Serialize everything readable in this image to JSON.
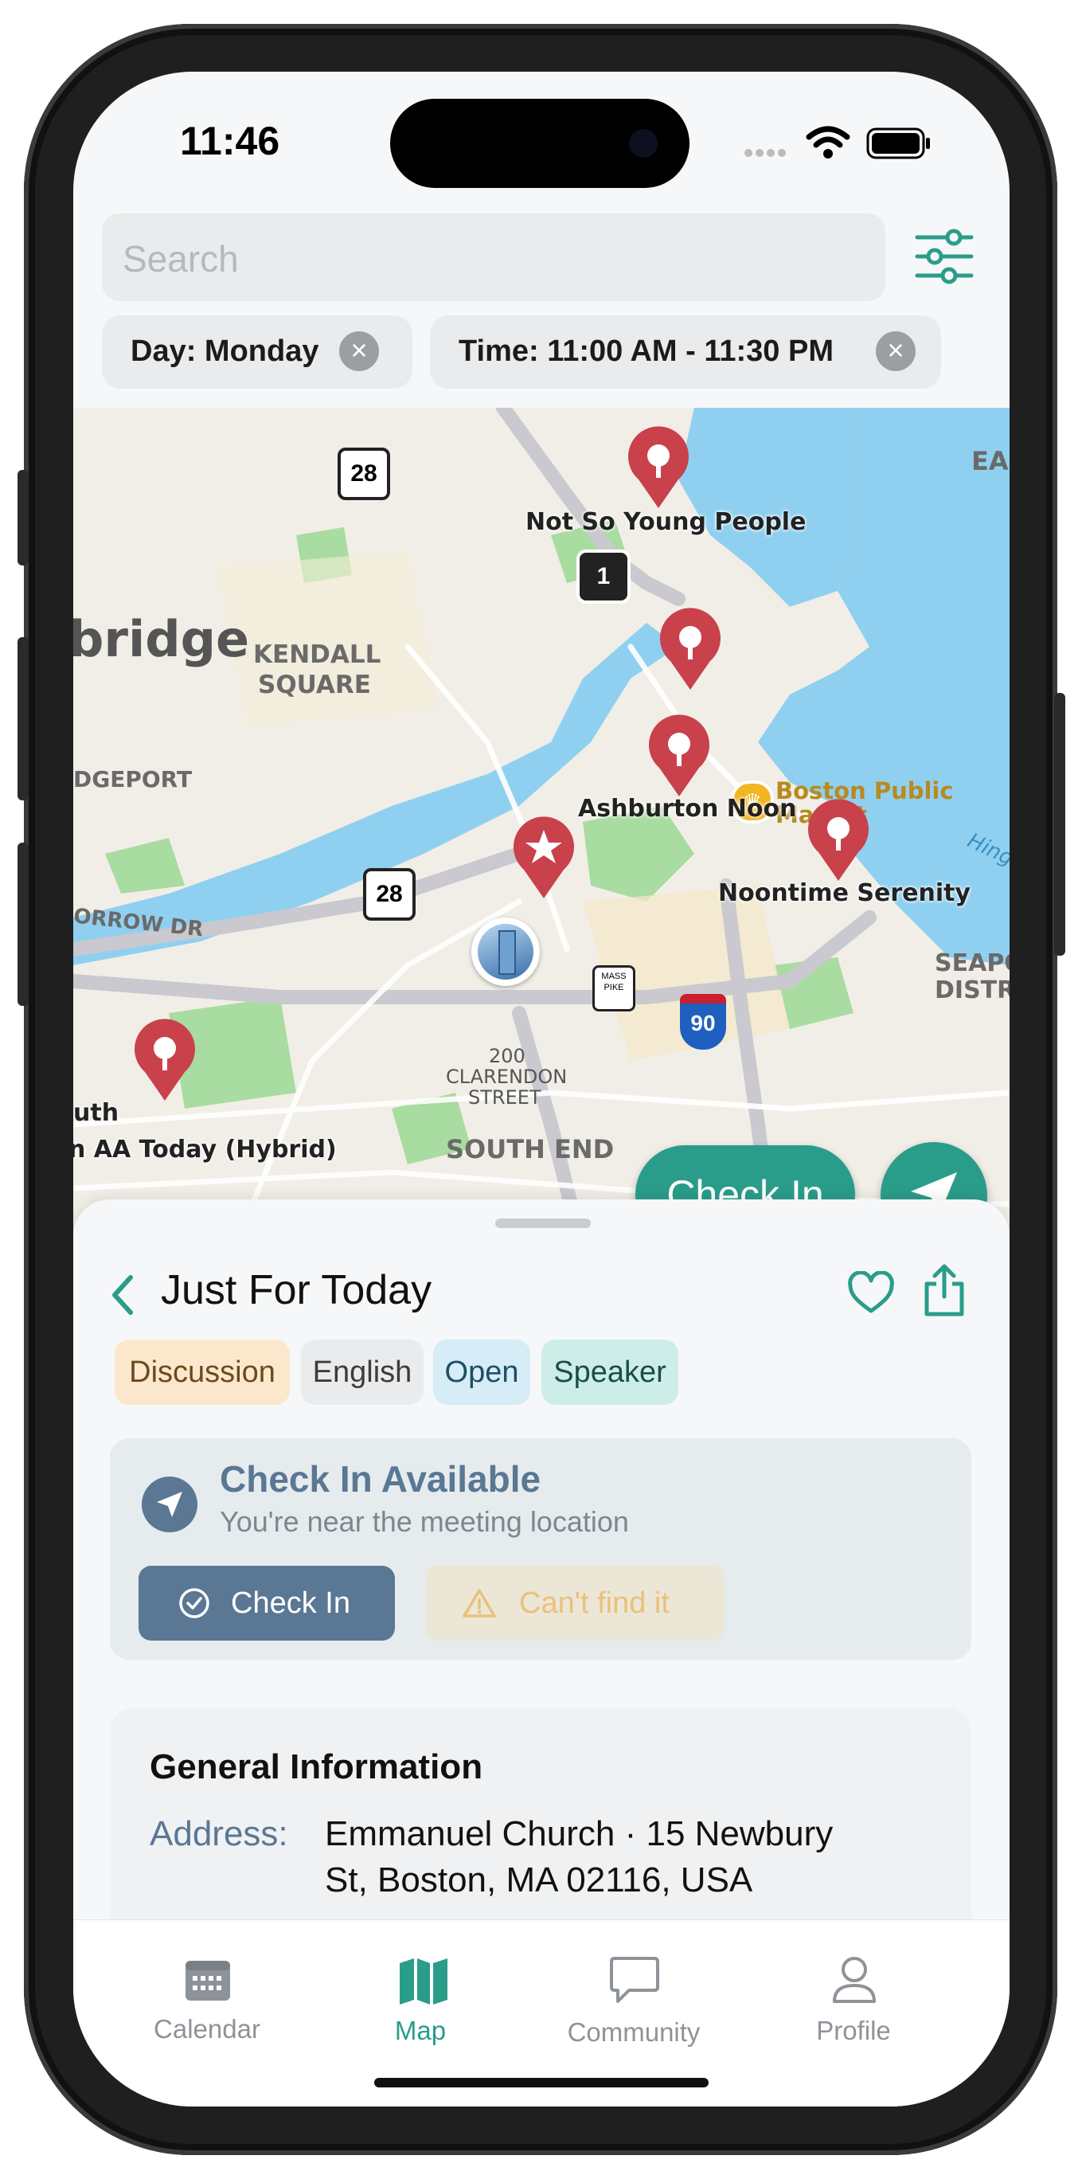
{
  "status": {
    "time": "11:46"
  },
  "search": {
    "placeholder": "Search"
  },
  "filters": [
    {
      "label": "Day: Monday"
    },
    {
      "label": "Time: 11:00 AM - 11:30 PM"
    }
  ],
  "map": {
    "pin_labels": [
      "Not So Young People",
      "Ashburton Noon",
      "Noontime Serenity",
      "n AA Today (Hybrid)",
      "uth"
    ],
    "place_labels": [
      "bridge",
      "KENDALL",
      "SQUARE",
      "DGEPORT",
      "ORROW DR",
      "200",
      "CLARENDON",
      "STREET",
      "SOUTH END",
      "Boston Public",
      "Market",
      "EAS",
      "SEAPO",
      "DISTR",
      "Hing"
    ],
    "route_shields": [
      "28",
      "28",
      "1",
      "90",
      "MASS PIKE"
    ],
    "check_in_button": "Check In",
    "colors": {
      "water": "#8fd0f0",
      "park": "#a9dca0",
      "road": "#c9c9cf",
      "pin": "#c9414b"
    }
  },
  "sheet": {
    "title": "Just For Today",
    "tags": [
      {
        "label": "Discussion",
        "bg": "#fbe8cc",
        "fg": "#6b4a1f"
      },
      {
        "label": "English",
        "bg": "#e9ebed",
        "fg": "#3c3c3c"
      },
      {
        "label": "Open",
        "bg": "#d6ecf6",
        "fg": "#1e4f63"
      },
      {
        "label": "Speaker",
        "bg": "#cdeee8",
        "fg": "#1c4e46"
      }
    ],
    "checkin_card": {
      "title": "Check In Available",
      "subtitle": "You're near the meeting location",
      "primary": "Check In",
      "secondary": "Can't find it"
    },
    "general": {
      "heading": "General Information",
      "address_label": "Address:",
      "address_line1": "Emmanuel Church · 15 Newbury",
      "address_line2": "St, Boston, MA 02116, USA"
    }
  },
  "tabs": [
    {
      "label": "Calendar",
      "icon": "calendar-icon"
    },
    {
      "label": "Map",
      "icon": "map-icon",
      "active": true
    },
    {
      "label": "Community",
      "icon": "chat-bubble-icon"
    },
    {
      "label": "Profile",
      "icon": "person-icon"
    }
  ],
  "accent": "#2a9d8a"
}
